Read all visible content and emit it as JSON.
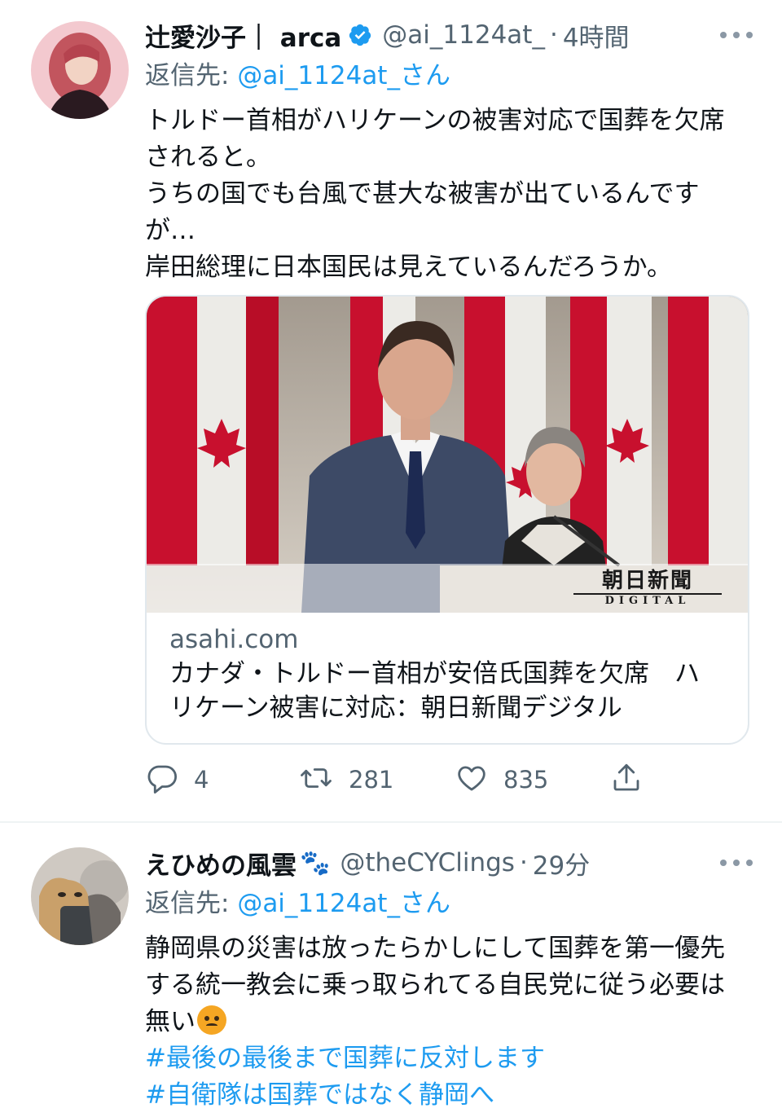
{
  "tweets": [
    {
      "name": "辻愛沙子｜ arca",
      "handle": "@ai_1124at_",
      "time": "4時間",
      "reply_label": "返信先:",
      "reply_to": "@ai_1124at_さん",
      "body": [
        "トルドー首相がハリケーンの被害対応で国葬を欠席",
        "されると。",
        "うちの国でも台風で甚大な被害が出ているんです",
        "が…",
        "岸田総理に日本国民は見えているんだろうか。"
      ],
      "card": {
        "watermark": "朝日新聞",
        "watermark_sub": "DIGITAL",
        "domain": "asahi.com",
        "title_lines": [
          "カナダ・トルドー首相が安倍氏国葬を欠席　ハ",
          "リケーン被害に対応：朝日新聞デジタル"
        ]
      },
      "stats": {
        "replies": "4",
        "retweets": "281",
        "likes": "835"
      }
    },
    {
      "name": "えひめの風雲",
      "name_suffix": "🐾",
      "handle": "@theCYClings",
      "time": "29分",
      "reply_label": "返信先:",
      "reply_to": "@ai_1124at_さん",
      "body": [
        "静岡県の災害は放ったらかしにして国葬を第一優先",
        "する統一教会に乗っ取られてる自民党に従う必要は",
        "無い"
      ],
      "hashtags": [
        "#最後の最後まで国葬に反対します",
        "#自衛隊は国葬ではなく静岡へ"
      ]
    }
  ],
  "icons": {
    "verified": "verified-badge-icon",
    "more": "more-icon",
    "reply": "reply-icon",
    "retweet": "retweet-icon",
    "like": "like-icon",
    "share": "share-icon",
    "emoji": "angry-face-emoji"
  },
  "colors": {
    "link": "#1d9bf0",
    "secondary": "#536471",
    "text": "#0f1419",
    "border": "#eff3f4"
  }
}
